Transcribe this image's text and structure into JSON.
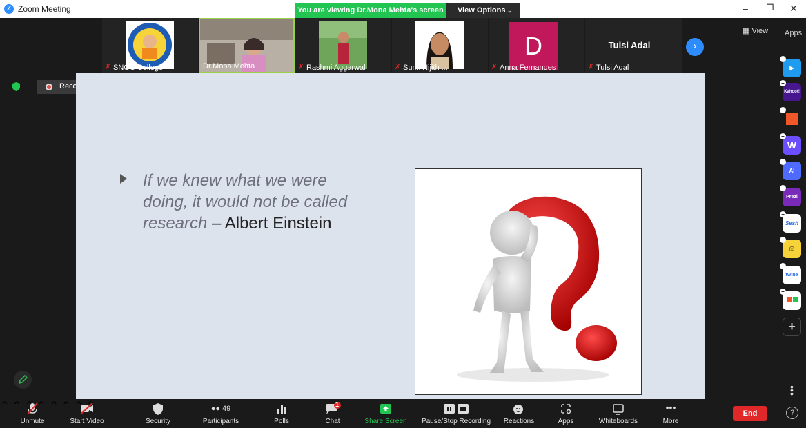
{
  "window": {
    "title": "Zoom Meeting",
    "viewing_banner": "You are viewing Dr.Mona Mehta's screen",
    "view_options_label": "View Options"
  },
  "participants": [
    {
      "name": "SNGC College",
      "muted": true
    },
    {
      "name": "Dr.Mona Mehta",
      "muted": false
    },
    {
      "name": "Rashmi Aggarwal",
      "muted": true
    },
    {
      "name": "Sumi Nijith ...",
      "muted": true
    },
    {
      "name": "Anna Fernandes",
      "muted": true,
      "avatar_letter": "D",
      "avatar_color": "#c0185a"
    },
    {
      "name": "Tulsi Adal",
      "muted": true,
      "center_name": "Tulsi Adal"
    }
  ],
  "view_button": "View",
  "apps_panel": {
    "label": "Apps",
    "items": [
      {
        "name": "pipe",
        "text": "",
        "color": "#1f9bf0"
      },
      {
        "name": "kahoot",
        "text": "Kahoot!",
        "color": "#46178f"
      },
      {
        "name": "orange-app",
        "text": "",
        "color": "#f0582a"
      },
      {
        "name": "wooclap",
        "text": "W",
        "color": "#6b4eff"
      },
      {
        "name": "ai-app",
        "text": "AI",
        "color": "#4f6bff"
      },
      {
        "name": "prezi",
        "text": "Prezi",
        "color": "#7a2ab8"
      },
      {
        "name": "sesh",
        "text": "Sesh",
        "color": "#ffffff"
      },
      {
        "name": "emoji-app",
        "text": "",
        "color": "#f7d33a"
      },
      {
        "name": "twine",
        "text": "twine",
        "color": "#ffffff"
      },
      {
        "name": "blocks-app",
        "text": "",
        "color": "#ffffff"
      }
    ],
    "add_label": "+"
  },
  "recording": {
    "label": "Recording..."
  },
  "slide": {
    "quote_italic": "If we knew what we were doing, it would not be called research",
    "quote_author": " – Albert Einstein"
  },
  "toolbar": {
    "unmute": "Unmute",
    "start_video": "Start Video",
    "security": "Security",
    "participants": "Participants",
    "participants_count": "49",
    "polls": "Polls",
    "chat": "Chat",
    "chat_badge": "1",
    "share_screen": "Share Screen",
    "pause_stop_recording": "Pause/Stop Recording",
    "reactions": "Reactions",
    "apps": "Apps",
    "whiteboards": "Whiteboards",
    "more": "More",
    "end": "End"
  },
  "colors": {
    "accent": "#2d8cff",
    "banner_green": "#23c552",
    "end_red": "#e02828",
    "share_green": "#23c552"
  }
}
